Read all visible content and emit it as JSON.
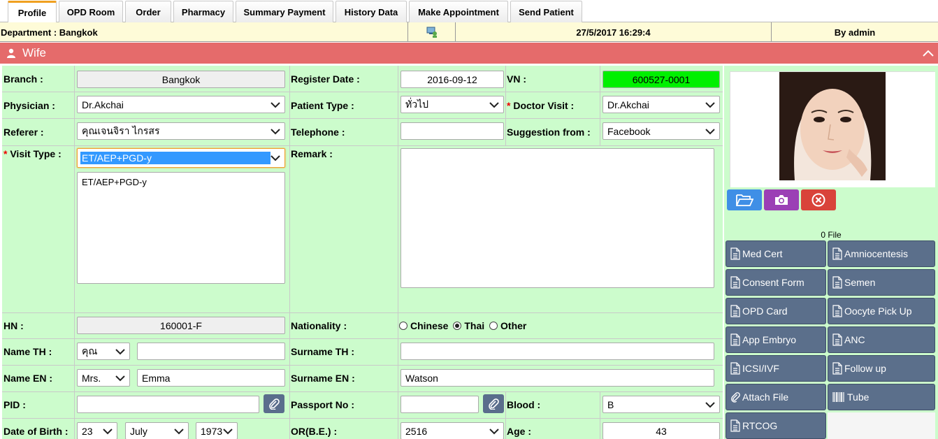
{
  "tabs": [
    "Profile",
    "OPD Room",
    "Order",
    "Pharmacy",
    "Summary Payment",
    "History Data",
    "Make Appointment",
    "Send Patient"
  ],
  "infobar": {
    "department": "Department : Bangkok",
    "datetime": "27/5/2017 16:29:4",
    "user": "By admin"
  },
  "section": {
    "title": "Wife"
  },
  "form": {
    "branch": {
      "label": "Branch :",
      "value": "Bangkok"
    },
    "register_date": {
      "label": "Register Date :",
      "value": "2016-09-12"
    },
    "vn": {
      "label": "VN :",
      "value": "600527-0001"
    },
    "physician": {
      "label": "Physician :",
      "value": "Dr.Akchai"
    },
    "patient_type": {
      "label": "Patient Type :",
      "value": "ทั่วไป"
    },
    "doctor_visit": {
      "label": "Doctor Visit :",
      "value": "Dr.Akchai"
    },
    "referer": {
      "label": "Referer :",
      "value": "คุณเจนจิรา ไกรสร"
    },
    "telephone": {
      "label": "Telephone :",
      "value": ""
    },
    "suggestion": {
      "label": "Suggestion from :",
      "value": "Facebook"
    },
    "visit_type": {
      "label": "Visit Type :",
      "value": "ET/AEP+PGD-y",
      "list_text": "ET/AEP+PGD-y"
    },
    "remark": {
      "label": "Remark :",
      "value": ""
    },
    "hn": {
      "label": "HN :",
      "value": "160001-F"
    },
    "nationality": {
      "label": "Nationality :",
      "options": [
        "Chinese",
        "Thai",
        "Other"
      ],
      "selected": "Thai"
    },
    "name_th": {
      "label": "Name TH :",
      "prefix": "คุณ",
      "value": ""
    },
    "surname_th": {
      "label": "Surname TH :",
      "value": ""
    },
    "name_en": {
      "label": "Name EN :",
      "prefix": "Mrs.",
      "value": "Emma"
    },
    "surname_en": {
      "label": "Surname EN :",
      "value": "Watson"
    },
    "pid": {
      "label": "PID :",
      "value": ""
    },
    "passport": {
      "label": "Passport No :",
      "value": ""
    },
    "blood": {
      "label": "Blood :",
      "value": "B"
    },
    "dob": {
      "label": "Date of Birth :",
      "day": "23",
      "month": "July",
      "year": "1973"
    },
    "or_be": {
      "label": "OR(B.E.) :",
      "value": "2516"
    },
    "age": {
      "label": "Age :",
      "value": "43"
    }
  },
  "right_panel": {
    "file_count": "0 File",
    "doc_buttons": [
      "Med Cert",
      "Amniocentesis",
      "Consent Form",
      "Semen",
      "OPD Card",
      "Oocyte Pick Up",
      "App Embryo",
      "ANC",
      "ICSI/IVF",
      "Follow up",
      "Attach File",
      "Tube",
      "RTCOG"
    ]
  },
  "colors": {
    "section_header": "#e56b6b",
    "form_bg": "#ccfccc",
    "vn_bg": "#00f000",
    "doc_button": "#5b6f8b",
    "camera_button": "#9b3fb5",
    "delete_button": "#d9433a",
    "folder_button": "#3f8fe6"
  }
}
